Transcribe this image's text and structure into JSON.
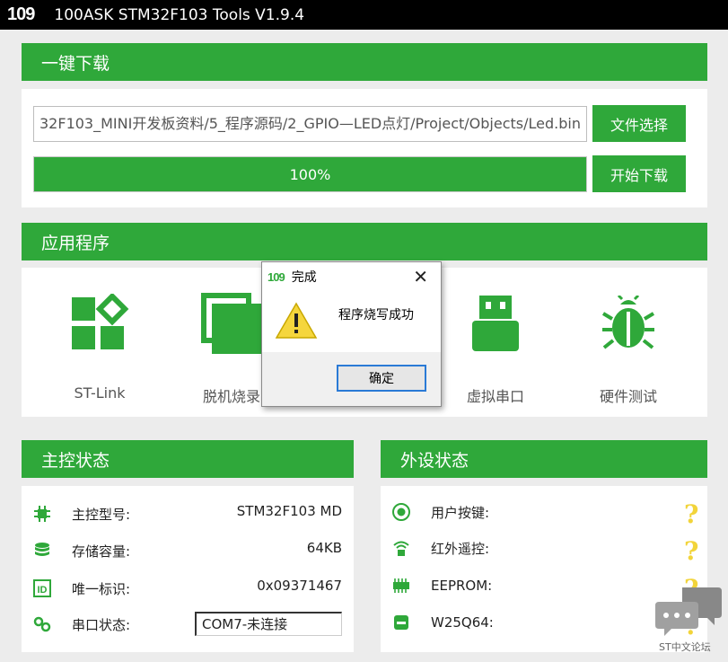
{
  "window": {
    "logo": "109",
    "title": "100ASK STM32F103 Tools V1.9.4"
  },
  "download": {
    "header": "一键下载",
    "file_path": "32F103_MINI开发板资料/5_程序源码/2_GPIO—LED点灯/Project/Objects/Led.bin",
    "select_button": "文件选择",
    "progress_value": 1.0,
    "progress_label": "100%",
    "start_button": "开始下载"
  },
  "apps": {
    "header": "应用程序",
    "items": [
      {
        "label": "ST-Link",
        "icon": "st-link-icon"
      },
      {
        "label": "脱机烧录",
        "icon": "offline-burn-icon"
      },
      {
        "label": "虚拟串口",
        "icon": "usb-icon"
      },
      {
        "label": "硬件测试",
        "icon": "bug-icon"
      }
    ]
  },
  "master": {
    "header": "主控状态",
    "rows": [
      {
        "key": "主控型号:",
        "value": "STM32F103 MD",
        "icon": "chip-icon"
      },
      {
        "key": "存储容量:",
        "value": "64KB",
        "icon": "database-icon"
      },
      {
        "key": "唯一标识:",
        "value": "0x09371467",
        "icon": "id-icon"
      },
      {
        "key": "串口状态:",
        "value": "COM7-未连接",
        "icon": "link-icon"
      }
    ]
  },
  "peripheral": {
    "header": "外设状态",
    "rows": [
      {
        "key": "用户按键:",
        "status": "?",
        "icon": "button-icon"
      },
      {
        "key": "红外遥控:",
        "status": "?",
        "icon": "infrared-icon"
      },
      {
        "key": "EEPROM:",
        "status": "?",
        "icon": "eeprom-icon"
      },
      {
        "key": "W25Q64:",
        "status": "?",
        "icon": "flash-icon"
      }
    ]
  },
  "dialog": {
    "logo": "109",
    "title": "完成",
    "message": "程序烧写成功",
    "ok_button": "确定"
  },
  "watermark": {
    "text": "ST中文论坛"
  },
  "colors": {
    "accent": "#2fa83a",
    "titlebar": "#000000",
    "warning": "#f2d43a"
  }
}
